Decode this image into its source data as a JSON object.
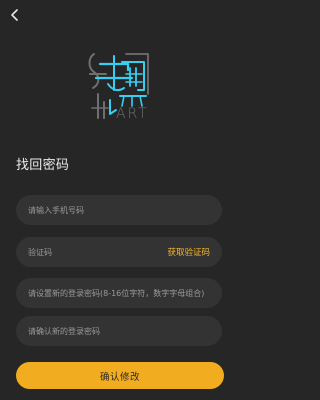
{
  "header": {
    "back_icon": "chevron-left-icon"
  },
  "logo": {
    "wordmark": "ART",
    "colors": {
      "cyan": "#35d0f0",
      "outline": "#6f6f6f"
    }
  },
  "page": {
    "title": "找回密码"
  },
  "form": {
    "phone": {
      "placeholder": "请输入手机号码",
      "value": ""
    },
    "code": {
      "placeholder": "验证码",
      "value": "",
      "action_label": "获取验证码"
    },
    "new_password": {
      "placeholder": "请设置新的登录密码(8-16位字符，数字字母组合)",
      "value": ""
    },
    "confirm_password": {
      "placeholder": "请确认新的登录密码",
      "value": ""
    },
    "submit_label": "确认修改"
  },
  "colors": {
    "background": "#262627",
    "field": "#333334",
    "accent": "#f1ad1f",
    "link": "#f0b632"
  }
}
